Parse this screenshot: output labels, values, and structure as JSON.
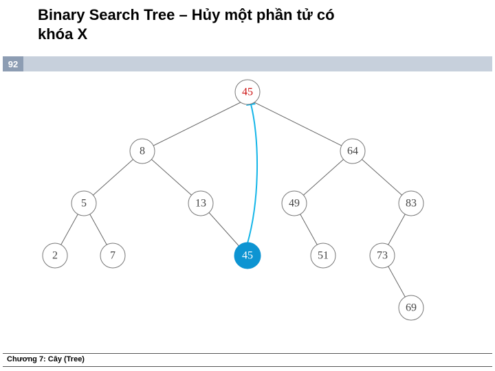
{
  "title_line1": "Binary Search Tree – Hủy một phần tử có",
  "title_line2": "khóa X",
  "slide_number": "92",
  "footer": "Chương 7: Cây (Tree)",
  "nodes": {
    "root": "45",
    "l": "8",
    "r": "64",
    "ll": "5",
    "lr": "13",
    "rl": "49",
    "rr": "83",
    "lll": "2",
    "llr": "7",
    "lrr": "45",
    "rlr": "51",
    "rrl": "73",
    "rrlr": "69"
  }
}
